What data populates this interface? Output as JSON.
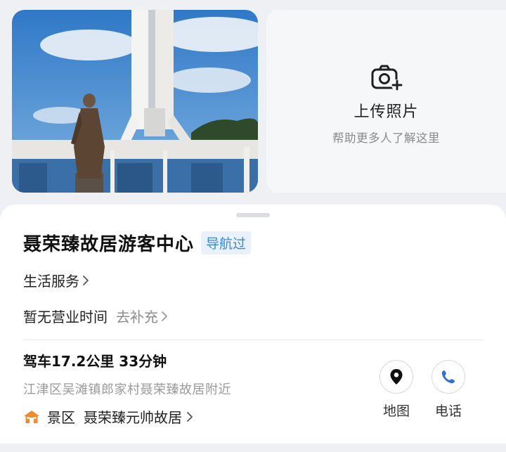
{
  "upload": {
    "icon": "camera-plus-icon",
    "title": "上传照片",
    "subtitle": "帮助更多人了解这里"
  },
  "poi": {
    "title": "聂荣臻故居游客中心",
    "badge": "导航过",
    "category": "生活服务",
    "hours": "暂无营业时间",
    "hours_action": "去补充",
    "drive_info": "驾车17.2公里 33分钟",
    "address": "江津区吴滩镇郎家村聂荣臻故居附近",
    "scenic": {
      "icon": "home-icon",
      "category": "景区",
      "name": "聂荣臻元帅故居"
    }
  },
  "actions": [
    {
      "icon": "location-pin-icon",
      "label": "地图"
    },
    {
      "icon": "phone-icon",
      "label": "电话"
    }
  ],
  "colors": {
    "accent": "#3a86d8",
    "badge_bg": "#e9f2fc",
    "scenic_icon": "#f08a2c",
    "phone_icon": "#2f6fd6"
  }
}
